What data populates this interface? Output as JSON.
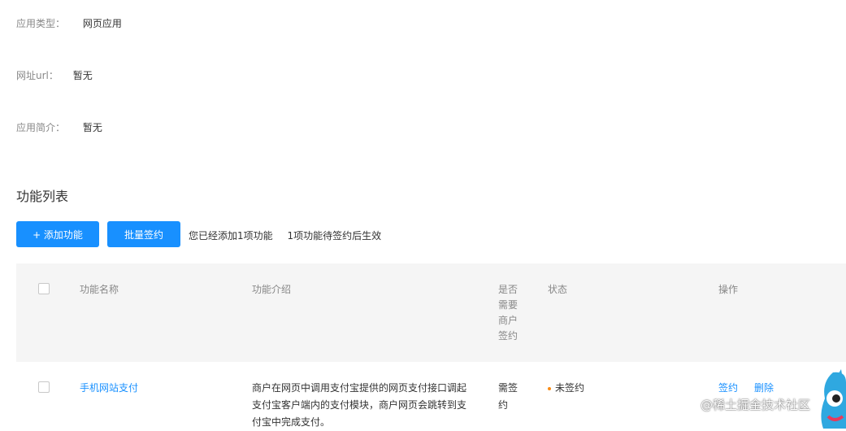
{
  "app_info": {
    "type_label": "应用类型：",
    "type_value": "网页应用",
    "url_label": "网址url：",
    "url_value": "暂无",
    "desc_label": "应用简介：",
    "desc_value": "暂无"
  },
  "section_title": "功能列表",
  "actions": {
    "add_label": "+ 添加功能",
    "batch_sign_label": "批量签约",
    "added_summary": "您已经添加1项功能",
    "pending_summary": "1项功能待签约后生效"
  },
  "table": {
    "headers": {
      "name": "功能名称",
      "intro": "功能介绍",
      "needs_sign": "是否需要商户签约",
      "status": "状态",
      "ops": "操作"
    },
    "rows": [
      {
        "name": "手机网站支付",
        "intro": "商户在网页中调用支付宝提供的网页支付接口调起支付宝客户端内的支付模块，商户网页会跳转到支付宝中完成支付。",
        "needs_sign": "需签约",
        "status": "未签约",
        "op_sign": "签约",
        "op_delete": "删除"
      }
    ]
  },
  "colors": {
    "primary": "#1890ff",
    "status_dot": "#fa8c16",
    "header_bg": "#f5f5f5"
  },
  "watermark": "@稀土掘金技术社区"
}
